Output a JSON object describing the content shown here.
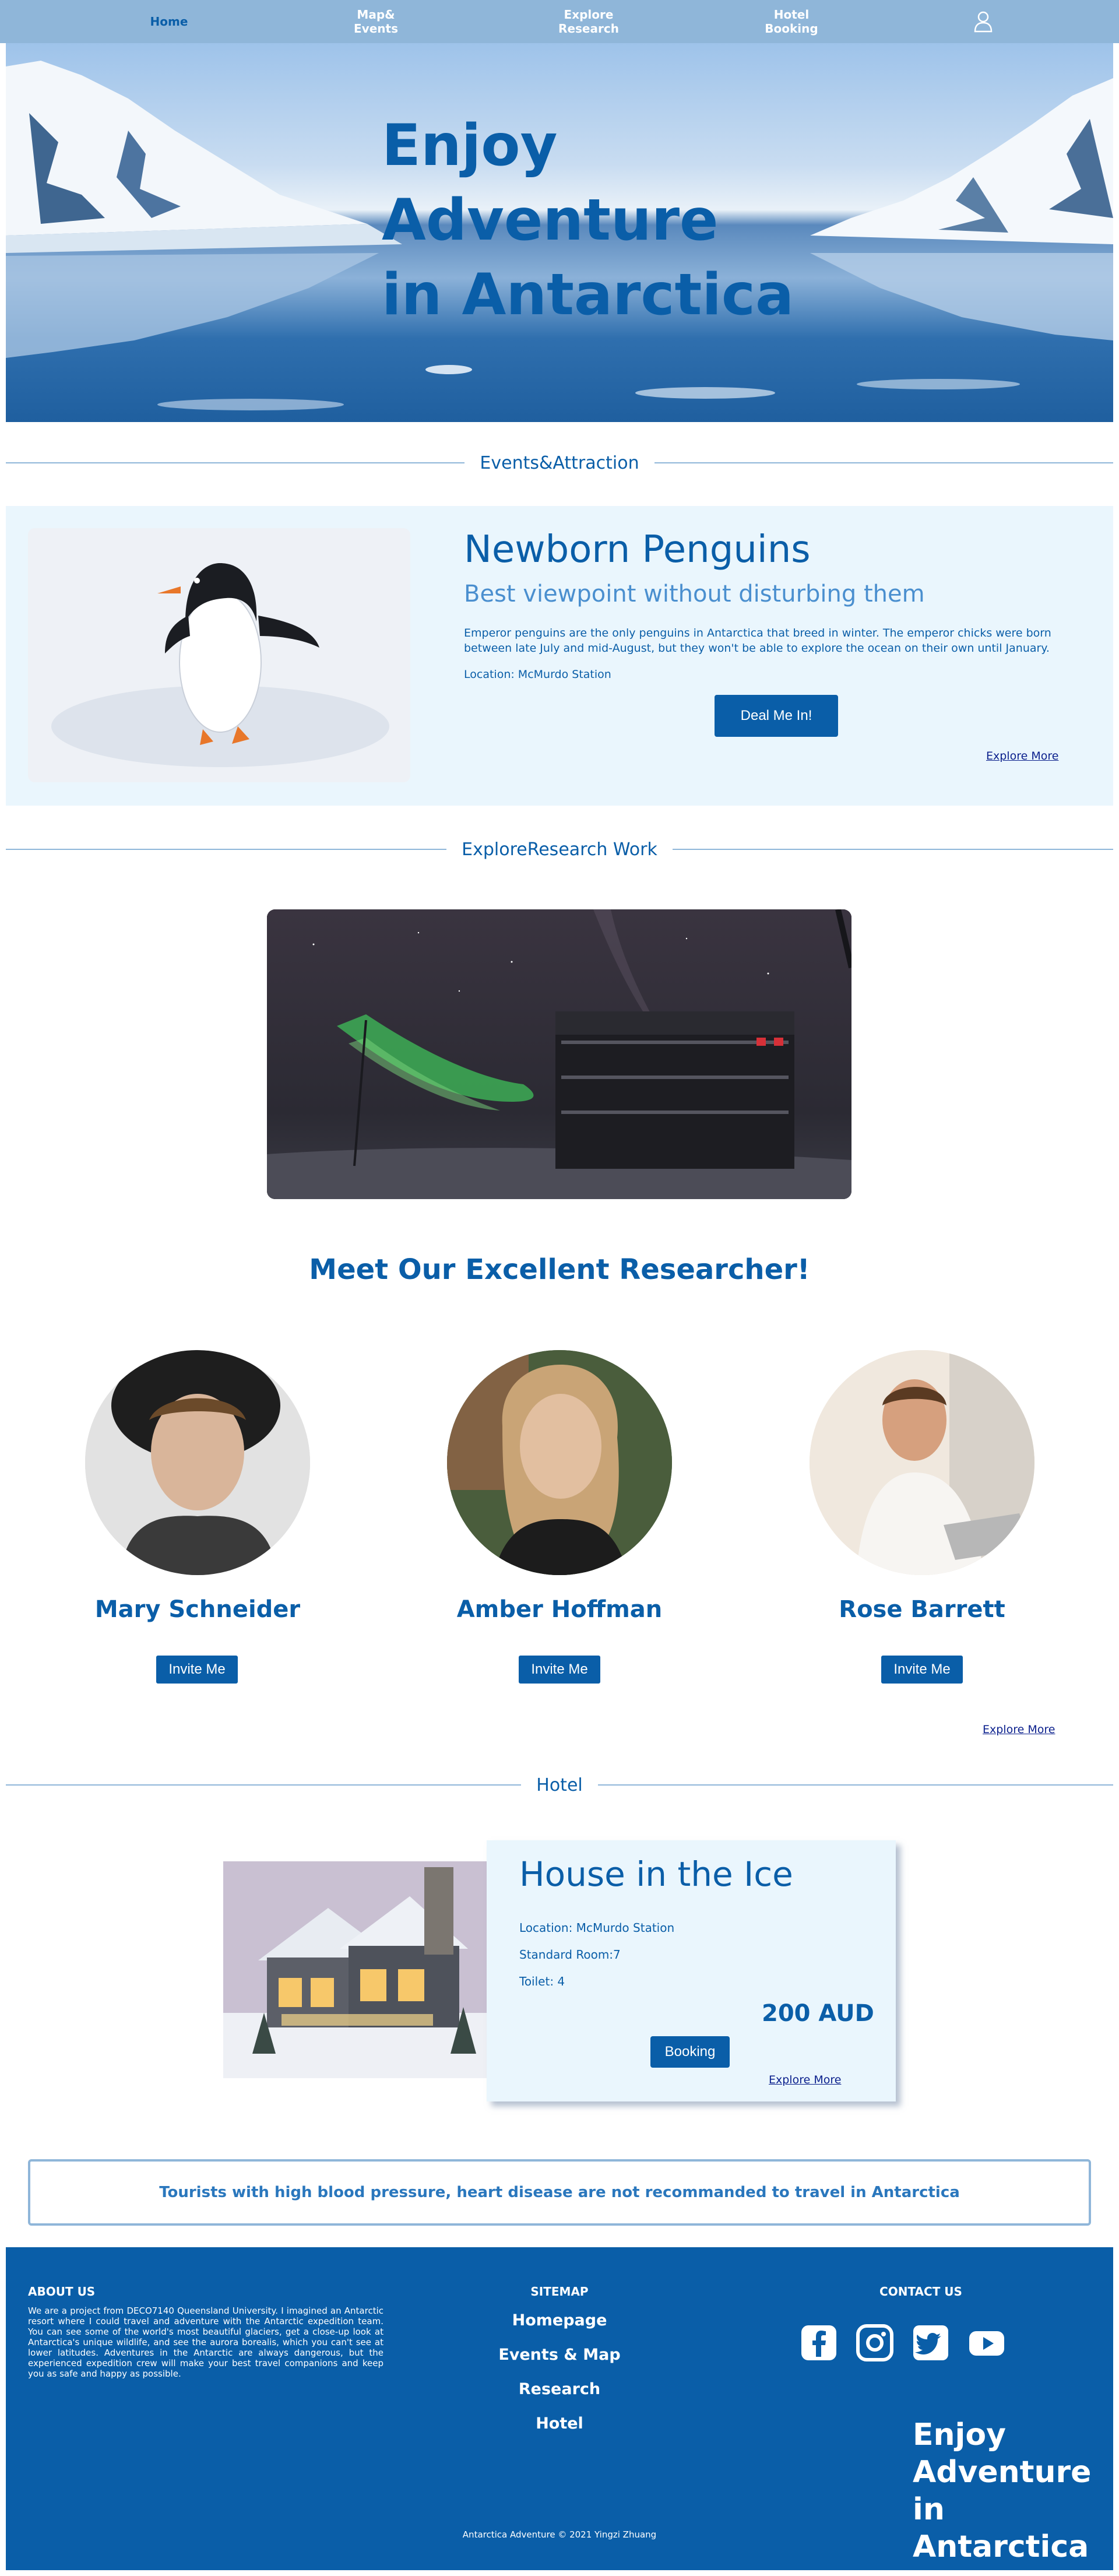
{
  "nav": {
    "items": [
      {
        "label": "Home",
        "active": true
      },
      {
        "label": "Map&\nEvents",
        "active": false
      },
      {
        "label": "Explore\nResearch",
        "active": false
      },
      {
        "label": "Hotel\nBooking",
        "active": false
      }
    ],
    "user_icon": "user-icon"
  },
  "hero": {
    "title": "Enjoy\nAdventure\nin Antarctica"
  },
  "sections": {
    "events": "Events&Attraction",
    "research": "ExploreResearch Work",
    "hotel": "Hotel"
  },
  "events": {
    "title": "Newborn Penguins",
    "subtitle": "Best viewpoint without disturbing them",
    "description": "Emperor penguins are the only penguins in Antarctica that breed in winter. The emperor chicks were born between late July and mid-August, but they won't be able to explore the ocean on their own until January.",
    "location": "Location: McMurdo Station",
    "cta": "Deal Me In!",
    "more": "Explore More"
  },
  "research": {
    "meet_title": "Meet Our Excellent Researcher!",
    "researchers": [
      {
        "name": "Mary Schneider",
        "button": "Invite Me"
      },
      {
        "name": "Amber Hoffman",
        "button": "Invite Me"
      },
      {
        "name": "Rose Barrett",
        "button": "Invite Me"
      }
    ],
    "more": "Explore More"
  },
  "hotel": {
    "title": "House in the Ice",
    "location": "Location: McMurdo Station",
    "rooms": "Standard Room:7",
    "toilet": "Toilet: 4",
    "price": "200 AUD",
    "cta": "Booking",
    "more": "Explore More"
  },
  "warning": "Tourists with high blood pressure, heart disease are not recommanded to travel in Antarctica",
  "footer": {
    "about_heading": "ABOUT US",
    "about_text": "We are a project from DECO7140 Queensland University. I imagined an Antarctic resort where I could travel and adventure with the Antarctic expedition team. You can see some of the world's most beautiful glaciers, get a close-up look at Antarctica's unique wildlife, and see the aurora borealis, which you can't see at lower latitudes. Adventures in the Antarctic are always dangerous, but the experienced expedition crew will make your best travel companions and keep you as safe and happy as possible.",
    "sitemap_heading": "SITEMAP",
    "sitemap": [
      "Homepage",
      "Events & Map",
      "Research",
      "Hotel"
    ],
    "contact_heading": "CONTACT US",
    "social": [
      "facebook-icon",
      "instagram-icon",
      "twitter-icon",
      "youtube-icon"
    ],
    "brand": "Enjoy\nAdventure\nin Antarctica",
    "copyright": "Antarctica Adventure © 2021 Yingzi Zhuang"
  },
  "colors": {
    "primary": "#0a5ea8",
    "nav_bg": "#8fb6d9",
    "panel_bg": "#eaf6fd",
    "footer_bg": "#0a5ea8"
  }
}
